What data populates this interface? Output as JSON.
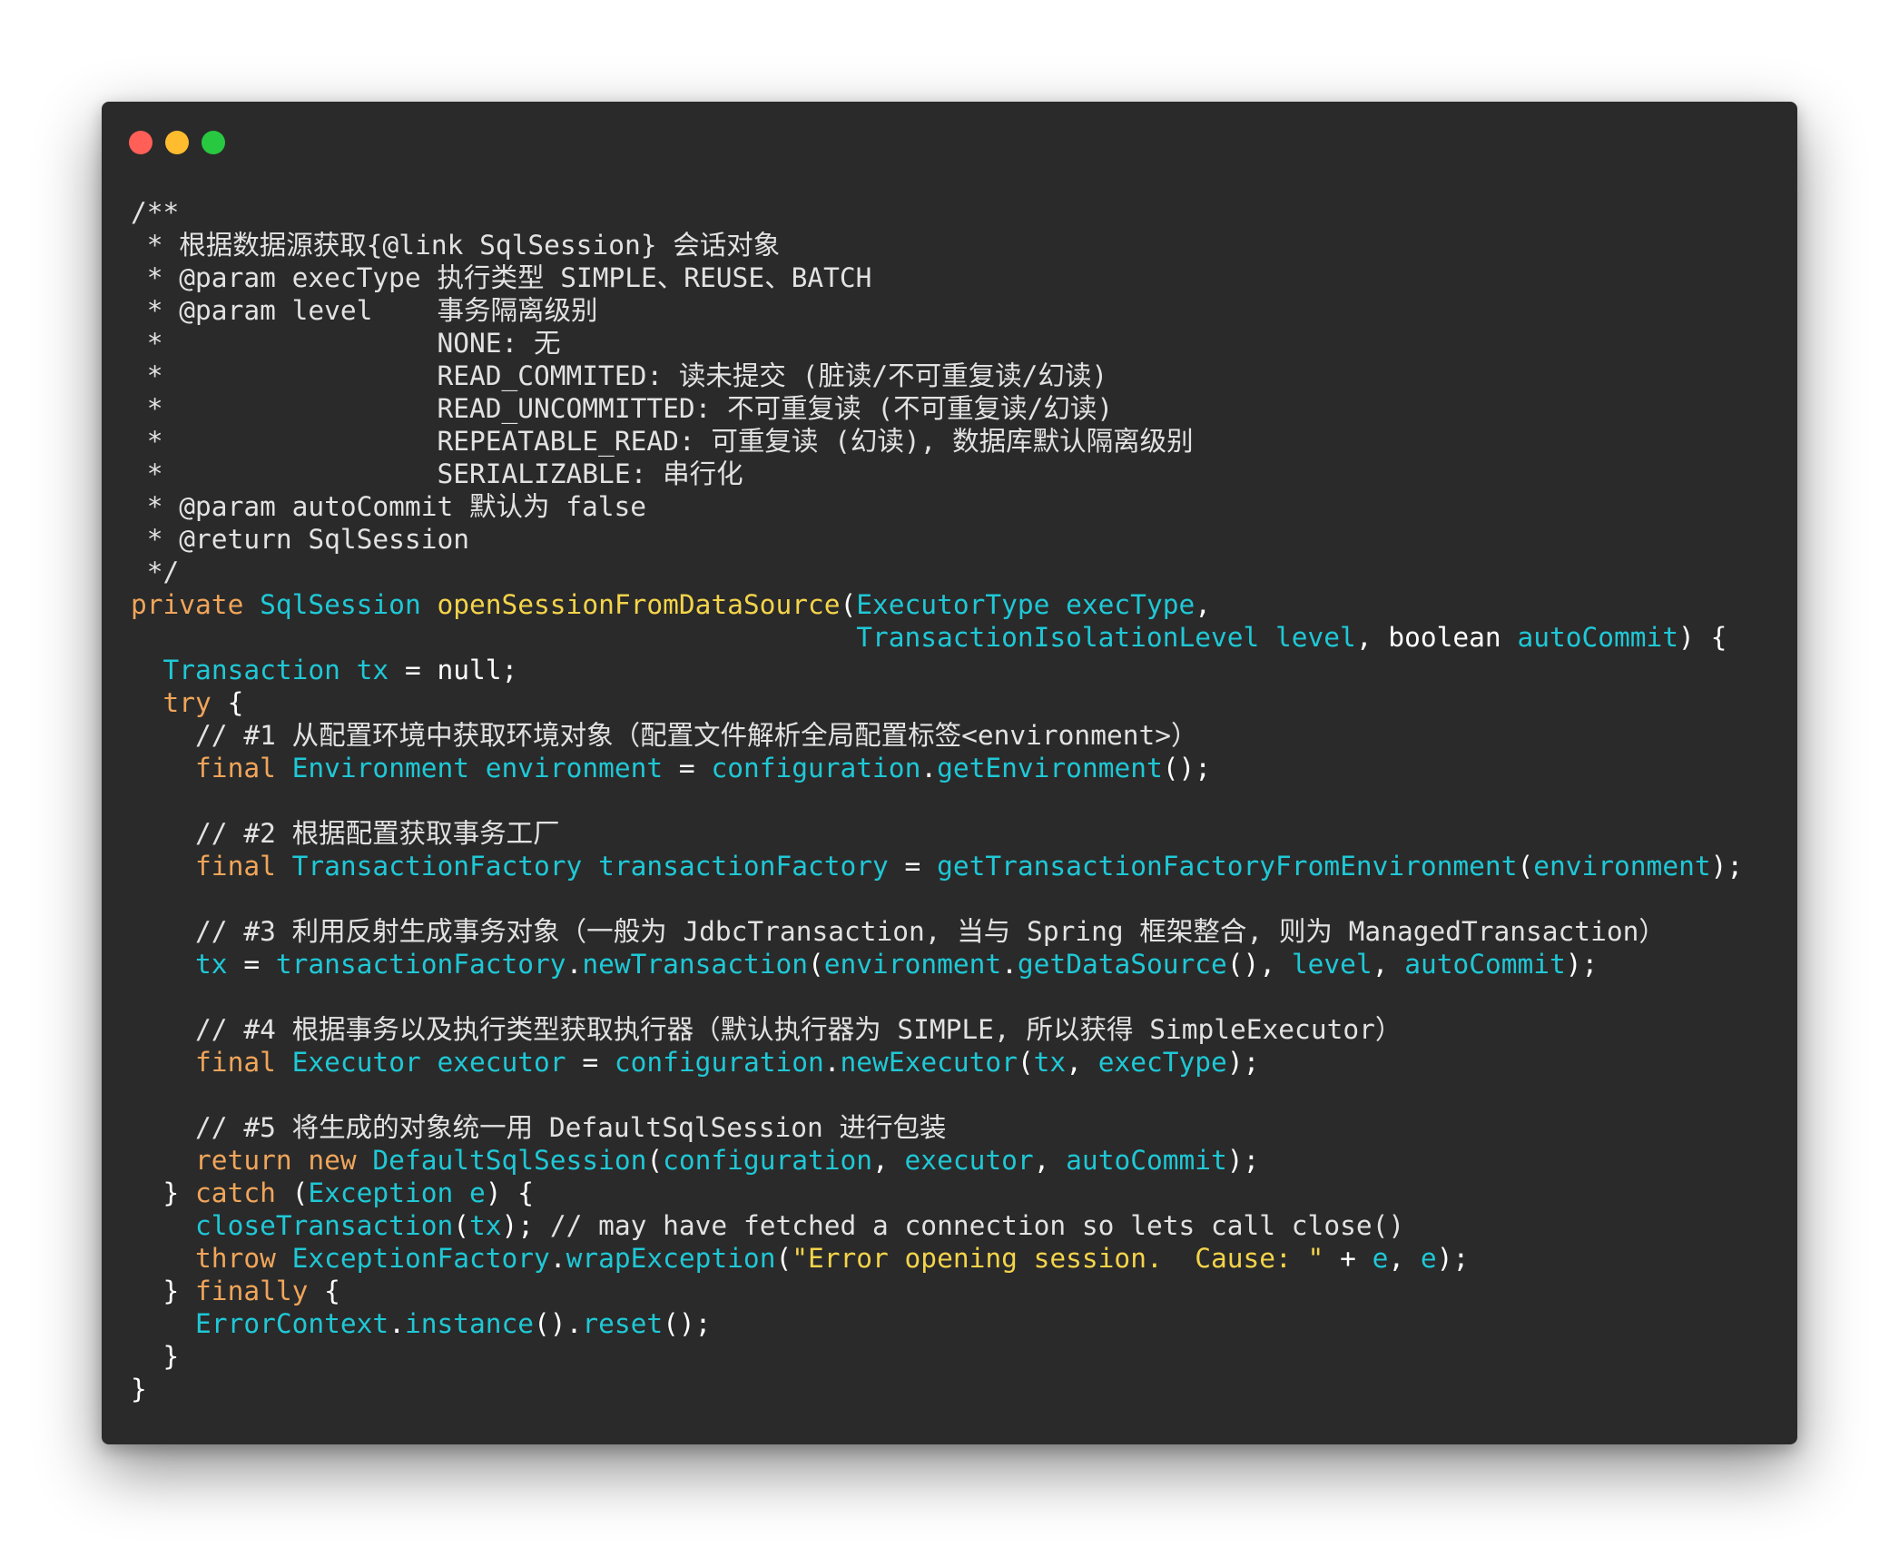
{
  "window": {
    "controls": [
      {
        "name": "close",
        "color": "#ff5f57"
      },
      {
        "name": "minimize",
        "color": "#febc2e"
      },
      {
        "name": "zoom",
        "color": "#28c840"
      }
    ]
  },
  "colors": {
    "background": "#2a2a2a",
    "comment": "#e2e2e2",
    "keyword": "#f0a55a",
    "type": "#1fc8d6",
    "function": "#f4d44a",
    "string": "#f4d44a",
    "plain": "#ffffff"
  },
  "code_lines": [
    [
      {
        "c": "cm",
        "t": "/**"
      }
    ],
    [
      {
        "c": "cm",
        "t": " * 根据数据源获取{@link SqlSession} 会话对象"
      }
    ],
    [
      {
        "c": "cm",
        "t": " * @param execType 执行类型 SIMPLE、REUSE、BATCH"
      }
    ],
    [
      {
        "c": "cm",
        "t": " * @param level    事务隔离级别"
      }
    ],
    [
      {
        "c": "cm",
        "t": " *                 NONE: 无"
      }
    ],
    [
      {
        "c": "cm",
        "t": " *                 READ_COMMITED: 读未提交 (脏读/不可重复读/幻读)"
      }
    ],
    [
      {
        "c": "cm",
        "t": " *                 READ_UNCOMMITTED: 不可重复读 (不可重复读/幻读)"
      }
    ],
    [
      {
        "c": "cm",
        "t": " *                 REPEATABLE_READ: 可重复读 (幻读), 数据库默认隔离级别"
      }
    ],
    [
      {
        "c": "cm",
        "t": " *                 SERIALIZABLE: 串行化"
      }
    ],
    [
      {
        "c": "cm",
        "t": " * @param autoCommit 默认为 false"
      }
    ],
    [
      {
        "c": "cm",
        "t": " * @return SqlSession"
      }
    ],
    [
      {
        "c": "cm",
        "t": " */"
      }
    ],
    [
      {
        "c": "kw",
        "t": "private "
      },
      {
        "c": "ty",
        "t": "SqlSession "
      },
      {
        "c": "fn",
        "t": "openSessionFromDataSource"
      },
      {
        "c": "pl",
        "t": "("
      },
      {
        "c": "ty",
        "t": "ExecutorType "
      },
      {
        "c": "id",
        "t": "execType"
      },
      {
        "c": "pl",
        "t": ","
      }
    ],
    [
      {
        "c": "pl",
        "t": "                                             "
      },
      {
        "c": "ty",
        "t": "TransactionIsolationLevel "
      },
      {
        "c": "id",
        "t": "level"
      },
      {
        "c": "pl",
        "t": ", boolean "
      },
      {
        "c": "id",
        "t": "autoCommit"
      },
      {
        "c": "pl",
        "t": ") {"
      }
    ],
    [
      {
        "c": "pl",
        "t": "  "
      },
      {
        "c": "ty",
        "t": "Transaction "
      },
      {
        "c": "id",
        "t": "tx"
      },
      {
        "c": "pl",
        "t": " = null;"
      }
    ],
    [
      {
        "c": "pl",
        "t": "  "
      },
      {
        "c": "kw",
        "t": "try"
      },
      {
        "c": "pl",
        "t": " {"
      }
    ],
    [
      {
        "c": "cm",
        "t": "    // #1 从配置环境中获取环境对象（配置文件解析全局配置标签<environment>）"
      }
    ],
    [
      {
        "c": "pl",
        "t": "    "
      },
      {
        "c": "kw",
        "t": "final "
      },
      {
        "c": "ty",
        "t": "Environment "
      },
      {
        "c": "id",
        "t": "environment"
      },
      {
        "c": "pl",
        "t": " = "
      },
      {
        "c": "id",
        "t": "configuration"
      },
      {
        "c": "pl",
        "t": "."
      },
      {
        "c": "id",
        "t": "getEnvironment"
      },
      {
        "c": "pl",
        "t": "();"
      }
    ],
    [
      {
        "c": "pl",
        "t": ""
      }
    ],
    [
      {
        "c": "cm",
        "t": "    // #2 根据配置获取事务工厂"
      }
    ],
    [
      {
        "c": "pl",
        "t": "    "
      },
      {
        "c": "kw",
        "t": "final "
      },
      {
        "c": "ty",
        "t": "TransactionFactory "
      },
      {
        "c": "id",
        "t": "transactionFactory"
      },
      {
        "c": "pl",
        "t": " = "
      },
      {
        "c": "id",
        "t": "getTransactionFactoryFromEnvironment"
      },
      {
        "c": "pl",
        "t": "("
      },
      {
        "c": "id",
        "t": "environment"
      },
      {
        "c": "pl",
        "t": ");"
      }
    ],
    [
      {
        "c": "pl",
        "t": ""
      }
    ],
    [
      {
        "c": "cm",
        "t": "    // #3 利用反射生成事务对象（一般为 JdbcTransaction, 当与 Spring 框架整合, 则为 ManagedTransaction）"
      }
    ],
    [
      {
        "c": "pl",
        "t": "    "
      },
      {
        "c": "id",
        "t": "tx"
      },
      {
        "c": "pl",
        "t": " = "
      },
      {
        "c": "id",
        "t": "transactionFactory"
      },
      {
        "c": "pl",
        "t": "."
      },
      {
        "c": "id",
        "t": "newTransaction"
      },
      {
        "c": "pl",
        "t": "("
      },
      {
        "c": "id",
        "t": "environment"
      },
      {
        "c": "pl",
        "t": "."
      },
      {
        "c": "id",
        "t": "getDataSource"
      },
      {
        "c": "pl",
        "t": "(), "
      },
      {
        "c": "id",
        "t": "level"
      },
      {
        "c": "pl",
        "t": ", "
      },
      {
        "c": "id",
        "t": "autoCommit"
      },
      {
        "c": "pl",
        "t": ");"
      }
    ],
    [
      {
        "c": "pl",
        "t": ""
      }
    ],
    [
      {
        "c": "cm",
        "t": "    // #4 根据事务以及执行类型获取执行器（默认执行器为 SIMPLE, 所以获得 SimpleExecutor）"
      }
    ],
    [
      {
        "c": "pl",
        "t": "    "
      },
      {
        "c": "kw",
        "t": "final "
      },
      {
        "c": "ty",
        "t": "Executor "
      },
      {
        "c": "id",
        "t": "executor"
      },
      {
        "c": "pl",
        "t": " = "
      },
      {
        "c": "id",
        "t": "configuration"
      },
      {
        "c": "pl",
        "t": "."
      },
      {
        "c": "id",
        "t": "newExecutor"
      },
      {
        "c": "pl",
        "t": "("
      },
      {
        "c": "id",
        "t": "tx"
      },
      {
        "c": "pl",
        "t": ", "
      },
      {
        "c": "id",
        "t": "execType"
      },
      {
        "c": "pl",
        "t": ");"
      }
    ],
    [
      {
        "c": "pl",
        "t": ""
      }
    ],
    [
      {
        "c": "cm",
        "t": "    // #5 将生成的对象统一用 DefaultSqlSession 进行包装"
      }
    ],
    [
      {
        "c": "pl",
        "t": "    "
      },
      {
        "c": "kw",
        "t": "return new "
      },
      {
        "c": "ty",
        "t": "DefaultSqlSession"
      },
      {
        "c": "pl",
        "t": "("
      },
      {
        "c": "id",
        "t": "configuration"
      },
      {
        "c": "pl",
        "t": ", "
      },
      {
        "c": "id",
        "t": "executor"
      },
      {
        "c": "pl",
        "t": ", "
      },
      {
        "c": "id",
        "t": "autoCommit"
      },
      {
        "c": "pl",
        "t": ");"
      }
    ],
    [
      {
        "c": "pl",
        "t": "  } "
      },
      {
        "c": "kw",
        "t": "catch"
      },
      {
        "c": "pl",
        "t": " ("
      },
      {
        "c": "ty",
        "t": "Exception "
      },
      {
        "c": "id",
        "t": "e"
      },
      {
        "c": "pl",
        "t": ") {"
      }
    ],
    [
      {
        "c": "pl",
        "t": "    "
      },
      {
        "c": "id",
        "t": "closeTransaction"
      },
      {
        "c": "pl",
        "t": "("
      },
      {
        "c": "id",
        "t": "tx"
      },
      {
        "c": "pl",
        "t": "); "
      },
      {
        "c": "cm",
        "t": "// may have fetched a connection so lets call close()"
      }
    ],
    [
      {
        "c": "pl",
        "t": "    "
      },
      {
        "c": "kw",
        "t": "throw "
      },
      {
        "c": "ty",
        "t": "ExceptionFactory"
      },
      {
        "c": "pl",
        "t": "."
      },
      {
        "c": "id",
        "t": "wrapException"
      },
      {
        "c": "pl",
        "t": "("
      },
      {
        "c": "st",
        "t": "\"Error opening session.  Cause: \""
      },
      {
        "c": "pl",
        "t": " + "
      },
      {
        "c": "id",
        "t": "e"
      },
      {
        "c": "pl",
        "t": ", "
      },
      {
        "c": "id",
        "t": "e"
      },
      {
        "c": "pl",
        "t": ");"
      }
    ],
    [
      {
        "c": "pl",
        "t": "  } "
      },
      {
        "c": "kw",
        "t": "finally"
      },
      {
        "c": "pl",
        "t": " {"
      }
    ],
    [
      {
        "c": "pl",
        "t": "    "
      },
      {
        "c": "ty",
        "t": "ErrorContext"
      },
      {
        "c": "pl",
        "t": "."
      },
      {
        "c": "id",
        "t": "instance"
      },
      {
        "c": "pl",
        "t": "()."
      },
      {
        "c": "id",
        "t": "reset"
      },
      {
        "c": "pl",
        "t": "();"
      }
    ],
    [
      {
        "c": "pl",
        "t": "  }"
      }
    ],
    [
      {
        "c": "pl",
        "t": "}"
      }
    ]
  ]
}
